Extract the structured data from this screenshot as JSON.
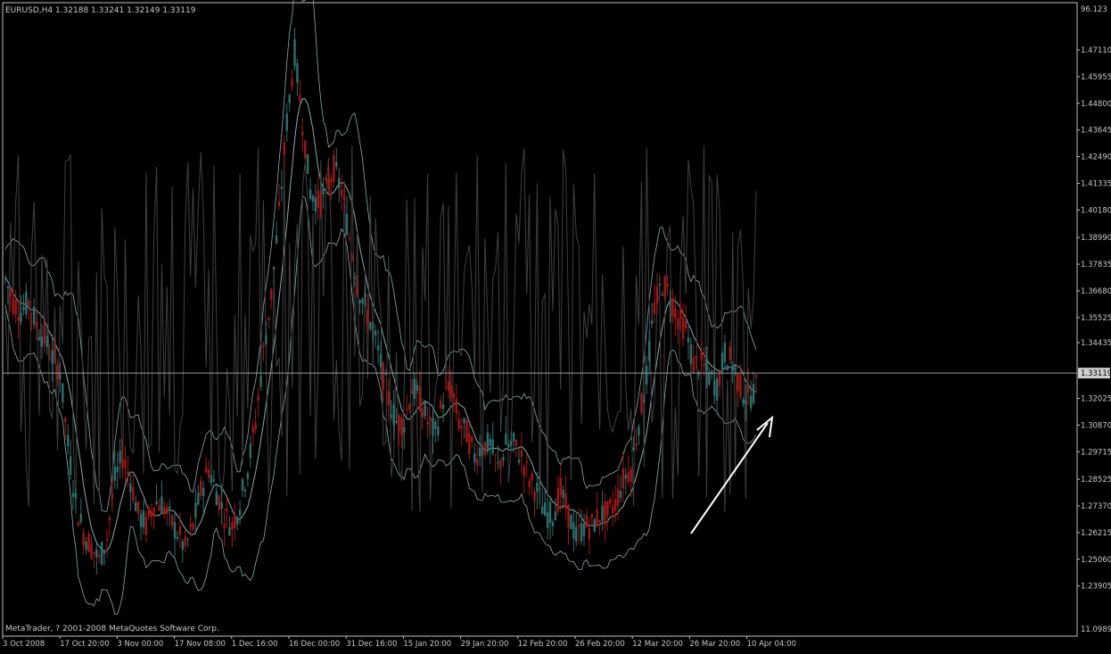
{
  "window": {
    "header_text": "EURUSD,H4  1.32188 1.33241 1.32149 1.33119",
    "footer_text": "MetaTrader, ? 2001-2008 MetaQuotes Software Corp."
  },
  "colors": {
    "background": "#000000",
    "frame": "#c0c0c0",
    "bull_candle": "#2f6f6f",
    "bear_candle": "#a01818",
    "band": "#8fa8a8",
    "indicator": "#404040",
    "current_price_line": "#9a9a9a",
    "price_tag_bg": "#d0d0d0",
    "arrow": "#ffffff"
  },
  "chart_data": {
    "type": "candlestick",
    "symbol": "EURUSD",
    "timeframe": "H4",
    "ohlc_current": {
      "open": 1.32188,
      "high": 1.33241,
      "low": 1.32149,
      "close": 1.33119
    },
    "ylim": [
      1.22,
      1.485
    ],
    "y_ticks": [
      "1.47110",
      "1.45955",
      "1.44800",
      "1.43645",
      "1.42490",
      "1.41335",
      "1.40180",
      "1.38990",
      "1.37835",
      "1.36680",
      "1.35525",
      "1.34435",
      "1.32025",
      "1.30870",
      "1.29715",
      "1.28525",
      "1.27370",
      "1.26215",
      "1.25060",
      "1.23905"
    ],
    "y_ticks_upper": [
      "96.123"
    ],
    "y_ticks_lower": [
      "11.0989"
    ],
    "current_price": 1.33119,
    "current_price_label": "1.33119",
    "x_ticks": [
      "3 Oct 2008",
      "17 Oct 20:00",
      "3 Nov 00:00",
      "17 Nov 08:00",
      "1 Dec 16:00",
      "16 Dec 00:00",
      "31 Dec 16:00",
      "15 Jan 20:00",
      "29 Jan 20:00",
      "12 Feb 20:00",
      "26 Feb 20:00",
      "12 Mar 20:00",
      "26 Mar 20:00",
      "10 Apr 04:00"
    ],
    "close_path": [
      [
        0,
        1.372
      ],
      [
        3,
        1.362
      ],
      [
        6,
        1.358
      ],
      [
        9,
        1.362
      ],
      [
        12,
        1.352
      ],
      [
        15,
        1.346
      ],
      [
        18,
        1.338
      ],
      [
        21,
        1.332
      ],
      [
        24,
        1.3
      ],
      [
        27,
        1.275
      ],
      [
        30,
        1.262
      ],
      [
        33,
        1.256
      ],
      [
        36,
        1.25
      ],
      [
        39,
        1.26
      ],
      [
        42,
        1.285
      ],
      [
        45,
        1.295
      ],
      [
        48,
        1.285
      ],
      [
        51,
        1.27
      ],
      [
        54,
        1.265
      ],
      [
        57,
        1.275
      ],
      [
        60,
        1.275
      ],
      [
        63,
        1.268
      ],
      [
        66,
        1.262
      ],
      [
        69,
        1.255
      ],
      [
        72,
        1.265
      ],
      [
        75,
        1.28
      ],
      [
        78,
        1.29
      ],
      [
        81,
        1.28
      ],
      [
        84,
        1.27
      ],
      [
        87,
        1.265
      ],
      [
        90,
        1.275
      ],
      [
        93,
        1.29
      ],
      [
        96,
        1.31
      ],
      [
        99,
        1.34
      ],
      [
        102,
        1.365
      ],
      [
        105,
        1.4
      ],
      [
        108,
        1.44
      ],
      [
        111,
        1.47
      ],
      [
        114,
        1.44
      ],
      [
        117,
        1.41
      ],
      [
        120,
        1.405
      ],
      [
        123,
        1.41
      ],
      [
        126,
        1.42
      ],
      [
        129,
        1.41
      ],
      [
        132,
        1.39
      ],
      [
        135,
        1.37
      ],
      [
        138,
        1.36
      ],
      [
        141,
        1.35
      ],
      [
        144,
        1.335
      ],
      [
        147,
        1.32
      ],
      [
        150,
        1.31
      ],
      [
        153,
        1.31
      ],
      [
        156,
        1.325
      ],
      [
        159,
        1.32
      ],
      [
        162,
        1.31
      ],
      [
        165,
        1.305
      ],
      [
        168,
        1.32
      ],
      [
        171,
        1.325
      ],
      [
        174,
        1.31
      ],
      [
        177,
        1.305
      ],
      [
        180,
        1.295
      ],
      [
        183,
        1.3
      ],
      [
        186,
        1.3
      ],
      [
        189,
        1.29
      ],
      [
        192,
        1.3
      ],
      [
        195,
        1.3
      ],
      [
        198,
        1.295
      ],
      [
        201,
        1.285
      ],
      [
        204,
        1.28
      ],
      [
        207,
        1.27
      ],
      [
        210,
        1.27
      ],
      [
        213,
        1.28
      ],
      [
        216,
        1.27
      ],
      [
        219,
        1.26
      ],
      [
        222,
        1.265
      ],
      [
        225,
        1.265
      ],
      [
        228,
        1.27
      ],
      [
        231,
        1.27
      ],
      [
        234,
        1.275
      ],
      [
        237,
        1.285
      ],
      [
        240,
        1.29
      ],
      [
        243,
        1.31
      ],
      [
        246,
        1.33
      ],
      [
        249,
        1.36
      ],
      [
        252,
        1.37
      ],
      [
        255,
        1.365
      ],
      [
        258,
        1.355
      ],
      [
        261,
        1.35
      ],
      [
        264,
        1.335
      ],
      [
        267,
        1.335
      ],
      [
        270,
        1.33
      ],
      [
        273,
        1.325
      ],
      [
        276,
        1.34
      ],
      [
        279,
        1.335
      ],
      [
        282,
        1.325
      ],
      [
        285,
        1.32
      ],
      [
        288,
        1.325
      ]
    ]
  }
}
